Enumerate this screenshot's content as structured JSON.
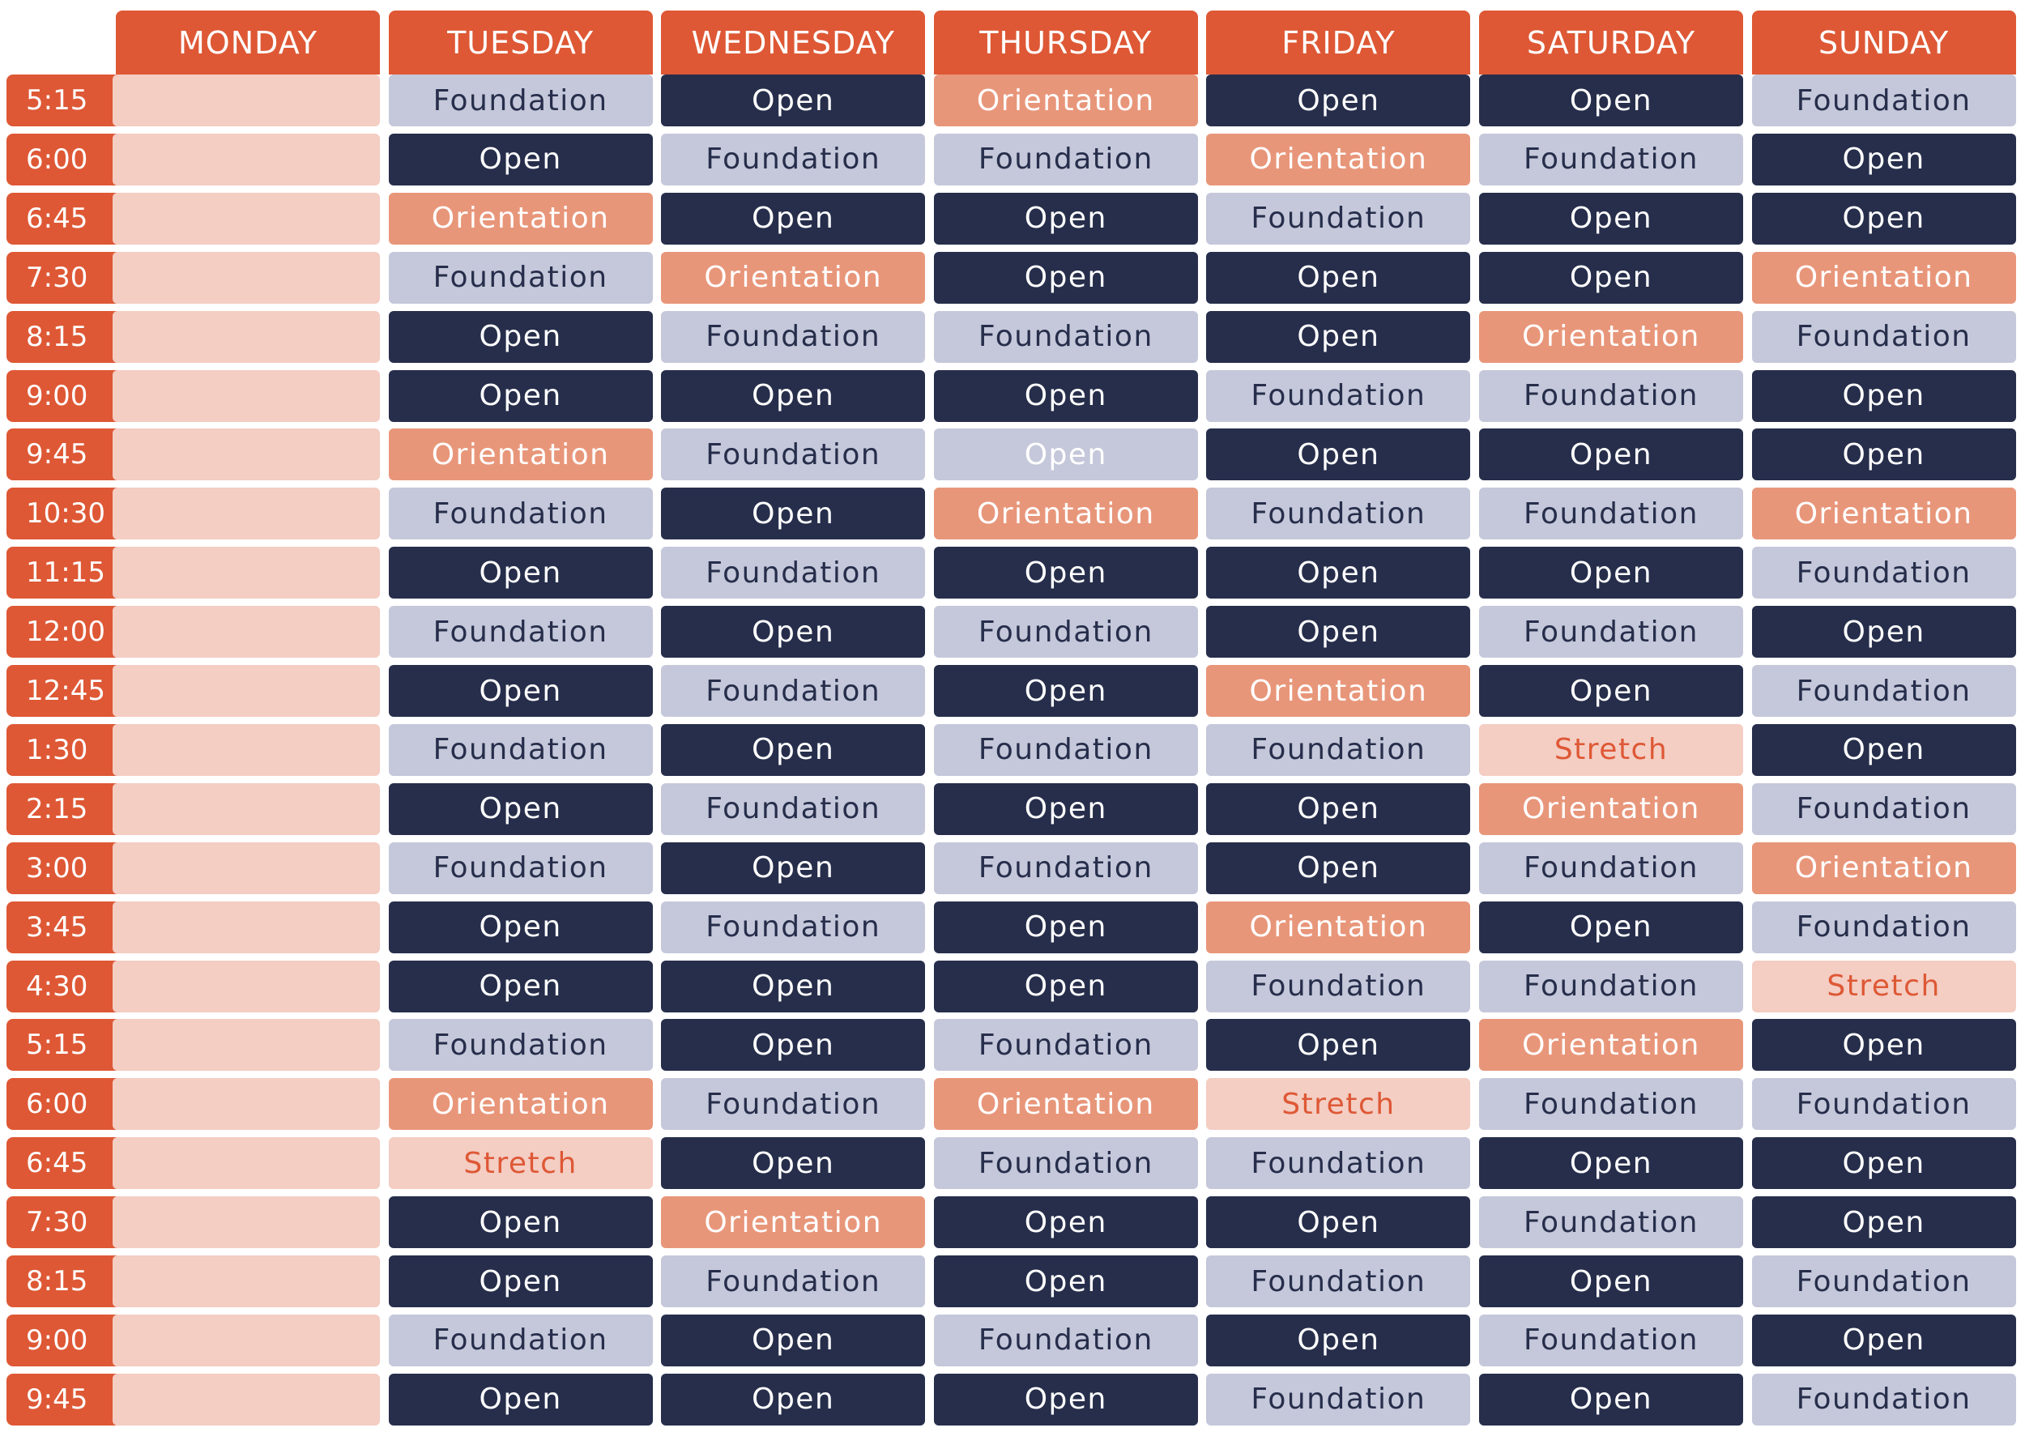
{
  "days": [
    "MONDAY",
    "TUESDAY",
    "WEDNESDAY",
    "THURSDAY",
    "FRIDAY",
    "SATURDAY",
    "SUNDAY"
  ],
  "styles": {
    "Foundation": {
      "bg": "#C5C8DA",
      "fg": "#262E4B"
    },
    "Open": {
      "bg": "#262E4B",
      "fg": "#FFFFFF"
    },
    "Orientation": {
      "bg": "#E8967A",
      "fg": "#FFFFFF"
    },
    "Stretch": {
      "bg": "#F4CDC3",
      "fg": "#DE5835"
    },
    "Open-muted": {
      "bg": "#C5C8DA",
      "fg": "#FFFFFF"
    },
    "Empty": {
      "bg": "#F4CDC3",
      "fg": "#F4CDC3"
    },
    "header": "#DE5835"
  },
  "rows": [
    {
      "time": "5:15",
      "cells": [
        "",
        "Foundation",
        "Open",
        "Orientation",
        "Open",
        "Open",
        "Foundation"
      ]
    },
    {
      "time": "6:00",
      "cells": [
        "",
        "Open",
        "Foundation",
        "Foundation",
        "Orientation",
        "Foundation",
        "Open"
      ]
    },
    {
      "time": "6:45",
      "cells": [
        "",
        "Orientation",
        "Open",
        "Open",
        "Foundation",
        "Open",
        "Open"
      ]
    },
    {
      "time": "7:30",
      "cells": [
        "",
        "Foundation",
        "Orientation",
        "Open",
        "Open",
        "Open",
        "Orientation"
      ]
    },
    {
      "time": "8:15",
      "cells": [
        "",
        "Open",
        "Foundation",
        "Foundation",
        "Open",
        "Orientation",
        "Foundation"
      ]
    },
    {
      "time": "9:00",
      "cells": [
        "",
        "Open",
        "Open",
        "Open",
        "Foundation",
        "Foundation",
        "Open"
      ]
    },
    {
      "time": "9:45",
      "cells": [
        "",
        "Orientation",
        "Foundation",
        "Open",
        "Open",
        "Open",
        "Open"
      ],
      "muted": [
        3
      ]
    },
    {
      "time": "10:30",
      "cells": [
        "",
        "Foundation",
        "Open",
        "Orientation",
        "Foundation",
        "Foundation",
        "Orientation"
      ]
    },
    {
      "time": "11:15",
      "cells": [
        "",
        "Open",
        "Foundation",
        "Open",
        "Open",
        "Open",
        "Foundation"
      ]
    },
    {
      "time": "12:00",
      "cells": [
        "",
        "Foundation",
        "Open",
        "Foundation",
        "Open",
        "Foundation",
        "Open"
      ]
    },
    {
      "time": "12:45",
      "cells": [
        "",
        "Open",
        "Foundation",
        "Open",
        "Orientation",
        "Open",
        "Foundation"
      ]
    },
    {
      "time": "1:30",
      "cells": [
        "",
        "Foundation",
        "Open",
        "Foundation",
        "Foundation",
        "Stretch",
        "Open"
      ]
    },
    {
      "time": "2:15",
      "cells": [
        "",
        "Open",
        "Foundation",
        "Open",
        "Open",
        "Orientation",
        "Foundation"
      ]
    },
    {
      "time": "3:00",
      "cells": [
        "",
        "Foundation",
        "Open",
        "Foundation",
        "Open",
        "Foundation",
        "Orientation"
      ]
    },
    {
      "time": "3:45",
      "cells": [
        "",
        "Open",
        "Foundation",
        "Open",
        "Orientation",
        "Open",
        "Foundation"
      ]
    },
    {
      "time": "4:30",
      "cells": [
        "",
        "Open",
        "Open",
        "Open",
        "Foundation",
        "Foundation",
        "Stretch"
      ]
    },
    {
      "time": "5:15",
      "cells": [
        "",
        "Foundation",
        "Open",
        "Foundation",
        "Open",
        "Orientation",
        "Open"
      ]
    },
    {
      "time": "6:00",
      "cells": [
        "",
        "Orientation",
        "Foundation",
        "Orientation",
        "Stretch",
        "Foundation",
        "Foundation"
      ]
    },
    {
      "time": "6:45",
      "cells": [
        "",
        "Stretch",
        "Open",
        "Foundation",
        "Foundation",
        "Open",
        "Open"
      ]
    },
    {
      "time": "7:30",
      "cells": [
        "",
        "Open",
        "Orientation",
        "Open",
        "Open",
        "Foundation",
        "Open"
      ]
    },
    {
      "time": "8:15",
      "cells": [
        "",
        "Open",
        "Foundation",
        "Open",
        "Foundation",
        "Open",
        "Foundation"
      ]
    },
    {
      "time": "9:00",
      "cells": [
        "",
        "Foundation",
        "Open",
        "Foundation",
        "Open",
        "Foundation",
        "Open"
      ]
    },
    {
      "time": "9:45",
      "cells": [
        "",
        "Open",
        "Open",
        "Open",
        "Foundation",
        "Open",
        "Foundation"
      ]
    }
  ]
}
